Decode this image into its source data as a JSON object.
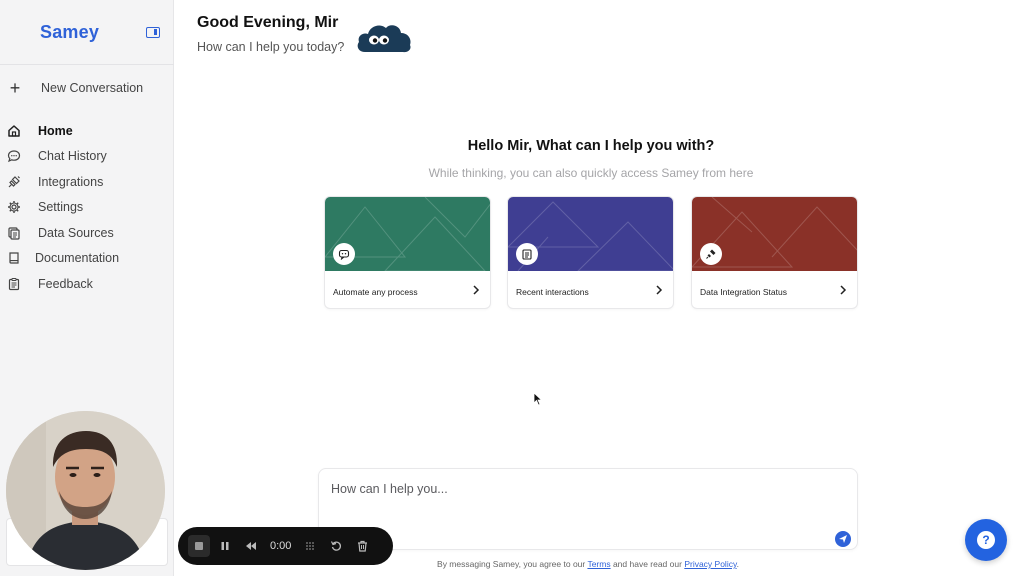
{
  "sidebar": {
    "logo": "Samey",
    "new_conversation": "New Conversation",
    "items": [
      {
        "label": "Home",
        "icon": "home-icon",
        "active": true
      },
      {
        "label": "Chat History",
        "icon": "chat-icon"
      },
      {
        "label": "Integrations",
        "icon": "plug-icon"
      },
      {
        "label": "Settings",
        "icon": "gear-icon"
      },
      {
        "label": "Data Sources",
        "icon": "database-icon"
      },
      {
        "label": "Documentation",
        "icon": "book-icon"
      },
      {
        "label": "Feedback",
        "icon": "clipboard-icon"
      }
    ]
  },
  "header": {
    "greeting": "Good Evening, Mir",
    "subtitle": "How can I help you today?"
  },
  "main": {
    "title": "Hello Mir, What can I help you with?",
    "subtitle": "While thinking, you can also quickly access Samey from here",
    "cards": [
      {
        "title": "Automate any process",
        "color": "#2e7a62",
        "icon": "bot-chat-icon"
      },
      {
        "title": "Recent interactions",
        "color": "#3f3e92",
        "icon": "clipboard-icon"
      },
      {
        "title": "Data Integration Status",
        "color": "#8a3128",
        "icon": "plug-icon"
      }
    ]
  },
  "chat": {
    "placeholder": "How can I help you...",
    "footer_prefix": "By messaging Samey, you agree to our ",
    "terms": "Terms",
    "footer_middle": " and have read our ",
    "privacy": "Privacy Policy",
    "footer_suffix": "."
  },
  "recorder": {
    "time": "0:00"
  },
  "colors": {
    "brand": "#2f62d8",
    "fab": "#2363e0"
  }
}
